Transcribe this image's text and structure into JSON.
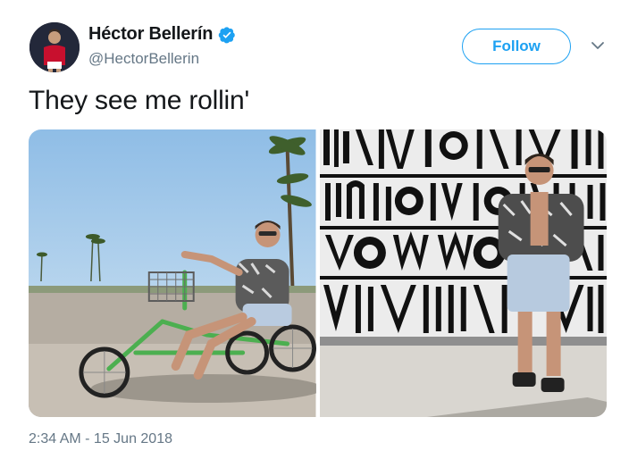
{
  "user": {
    "display_name": "Héctor Bellerín",
    "handle": "@HectorBellerin",
    "verified": true,
    "avatar_icon": "profile-photo"
  },
  "actions": {
    "follow_label": "Follow",
    "menu_icon": "chevron-down-icon"
  },
  "tweet": {
    "text": "They see me rollin'",
    "timestamp": "2:34 AM - 15 Jun 2018"
  },
  "media": {
    "count": 2,
    "photo_1_icon": "man-on-tricycle-photo",
    "photo_2_icon": "man-by-graffiti-wall-photo"
  },
  "colors": {
    "accent": "#1da1f2",
    "text": "#14171a",
    "secondary_text": "#657786"
  }
}
